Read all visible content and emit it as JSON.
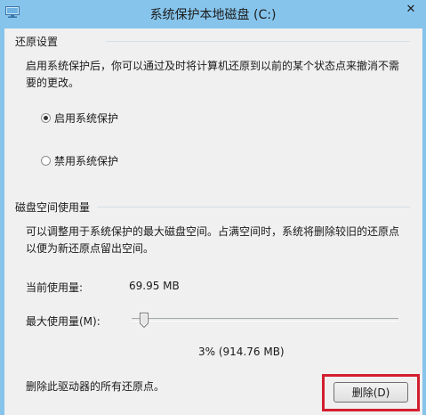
{
  "window": {
    "title": "系统保护本地磁盘 (C:)",
    "close_glyph": "✕"
  },
  "restore_settings": {
    "heading": "还原设置",
    "description_line1": "启用系统保护后，你可以通过及时将计算机还原到以前的某个状态点来撤消不需",
    "description_line2": "要的更改。",
    "options": [
      {
        "label": "启用系统保护",
        "selected": true
      },
      {
        "label": "禁用系统保护",
        "selected": false
      }
    ]
  },
  "disk_usage": {
    "heading": "磁盘空间使用量",
    "description_line1": "可以调整用于系统保护的最大磁盘空间。占满空间时，系统将删除较旧的还原点",
    "description_line2": "以便为新还原点留出空间。",
    "current_usage_label": "当前使用量:",
    "current_usage_value": "69.95 MB",
    "max_usage_label": "最大使用量(M):",
    "max_usage_fraction": 0.03,
    "max_usage_readout": "3% (914.76 MB)"
  },
  "delete_section": {
    "text": "删除此驱动器的所有还原点。",
    "button_label": "删除(D)"
  },
  "colors": {
    "titlebar": "#86c4ec",
    "highlight": "#d21f2f"
  },
  "icons": {
    "app": "system-protection-icon",
    "close": "close-icon"
  }
}
